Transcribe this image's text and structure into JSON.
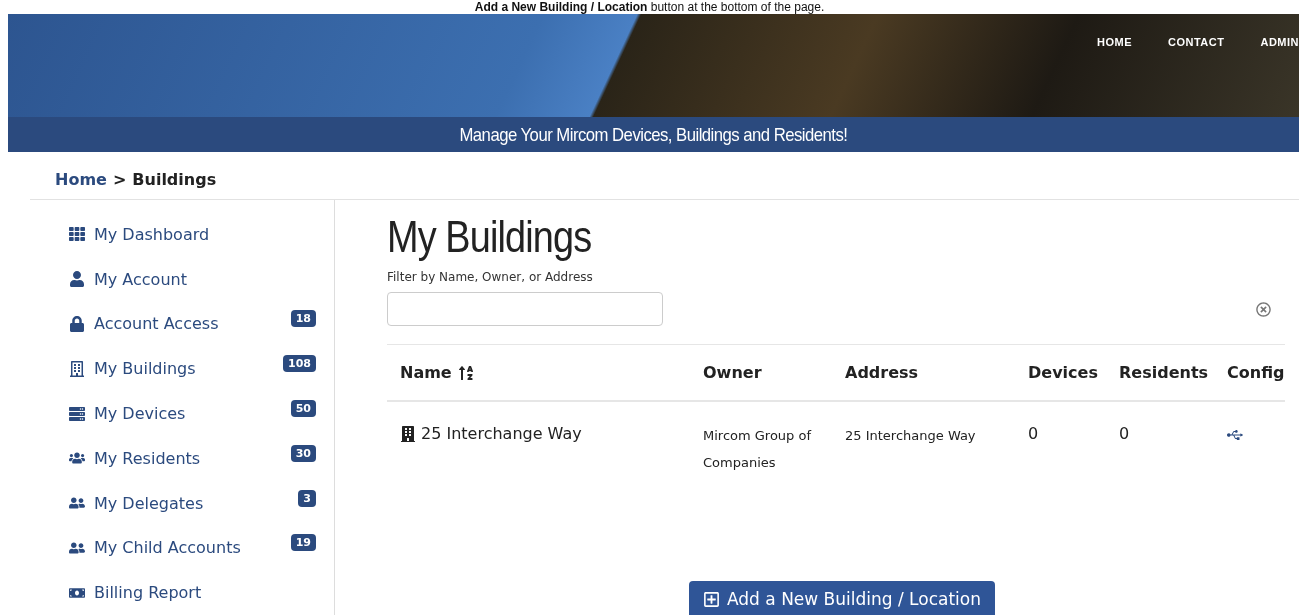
{
  "caption": "**Add a New Building / Location** button at the bottom of the page.",
  "nav": [
    "HOME",
    "CONTACT",
    "ADMIN"
  ],
  "tagline": "Manage Your Mircom Devices, Buildings and Residents!",
  "breadcrumb": {
    "link": "Home",
    "separator": ">",
    "current": "Buildings"
  },
  "sidebar": {
    "items": [
      {
        "label": "My Dashboard"
      },
      {
        "label": "My Account"
      },
      {
        "label": "Account Access",
        "badge": "18"
      },
      {
        "label": "My Buildings",
        "badge": "108"
      },
      {
        "label": "My Devices",
        "badge": "50"
      },
      {
        "label": "My Residents",
        "badge": "30"
      },
      {
        "label": "My Delegates",
        "badge": "3"
      },
      {
        "label": "My Child Accounts",
        "badge": "19"
      },
      {
        "label": "Billing Report"
      }
    ]
  },
  "main": {
    "title": "My Buildings",
    "filter": {
      "label": "Filter by Name, Owner, or Address"
    },
    "table": {
      "columns": [
        "Name",
        "Owner",
        "Address",
        "Devices",
        "Residents",
        "Config"
      ],
      "rows": [
        {
          "name": "25 Interchange Way",
          "owner": "Mircom Group of Companies",
          "address": "25 Interchange Way",
          "devices": "0",
          "residents": "0"
        }
      ]
    },
    "add_button": "Add a New Building / Location"
  }
}
